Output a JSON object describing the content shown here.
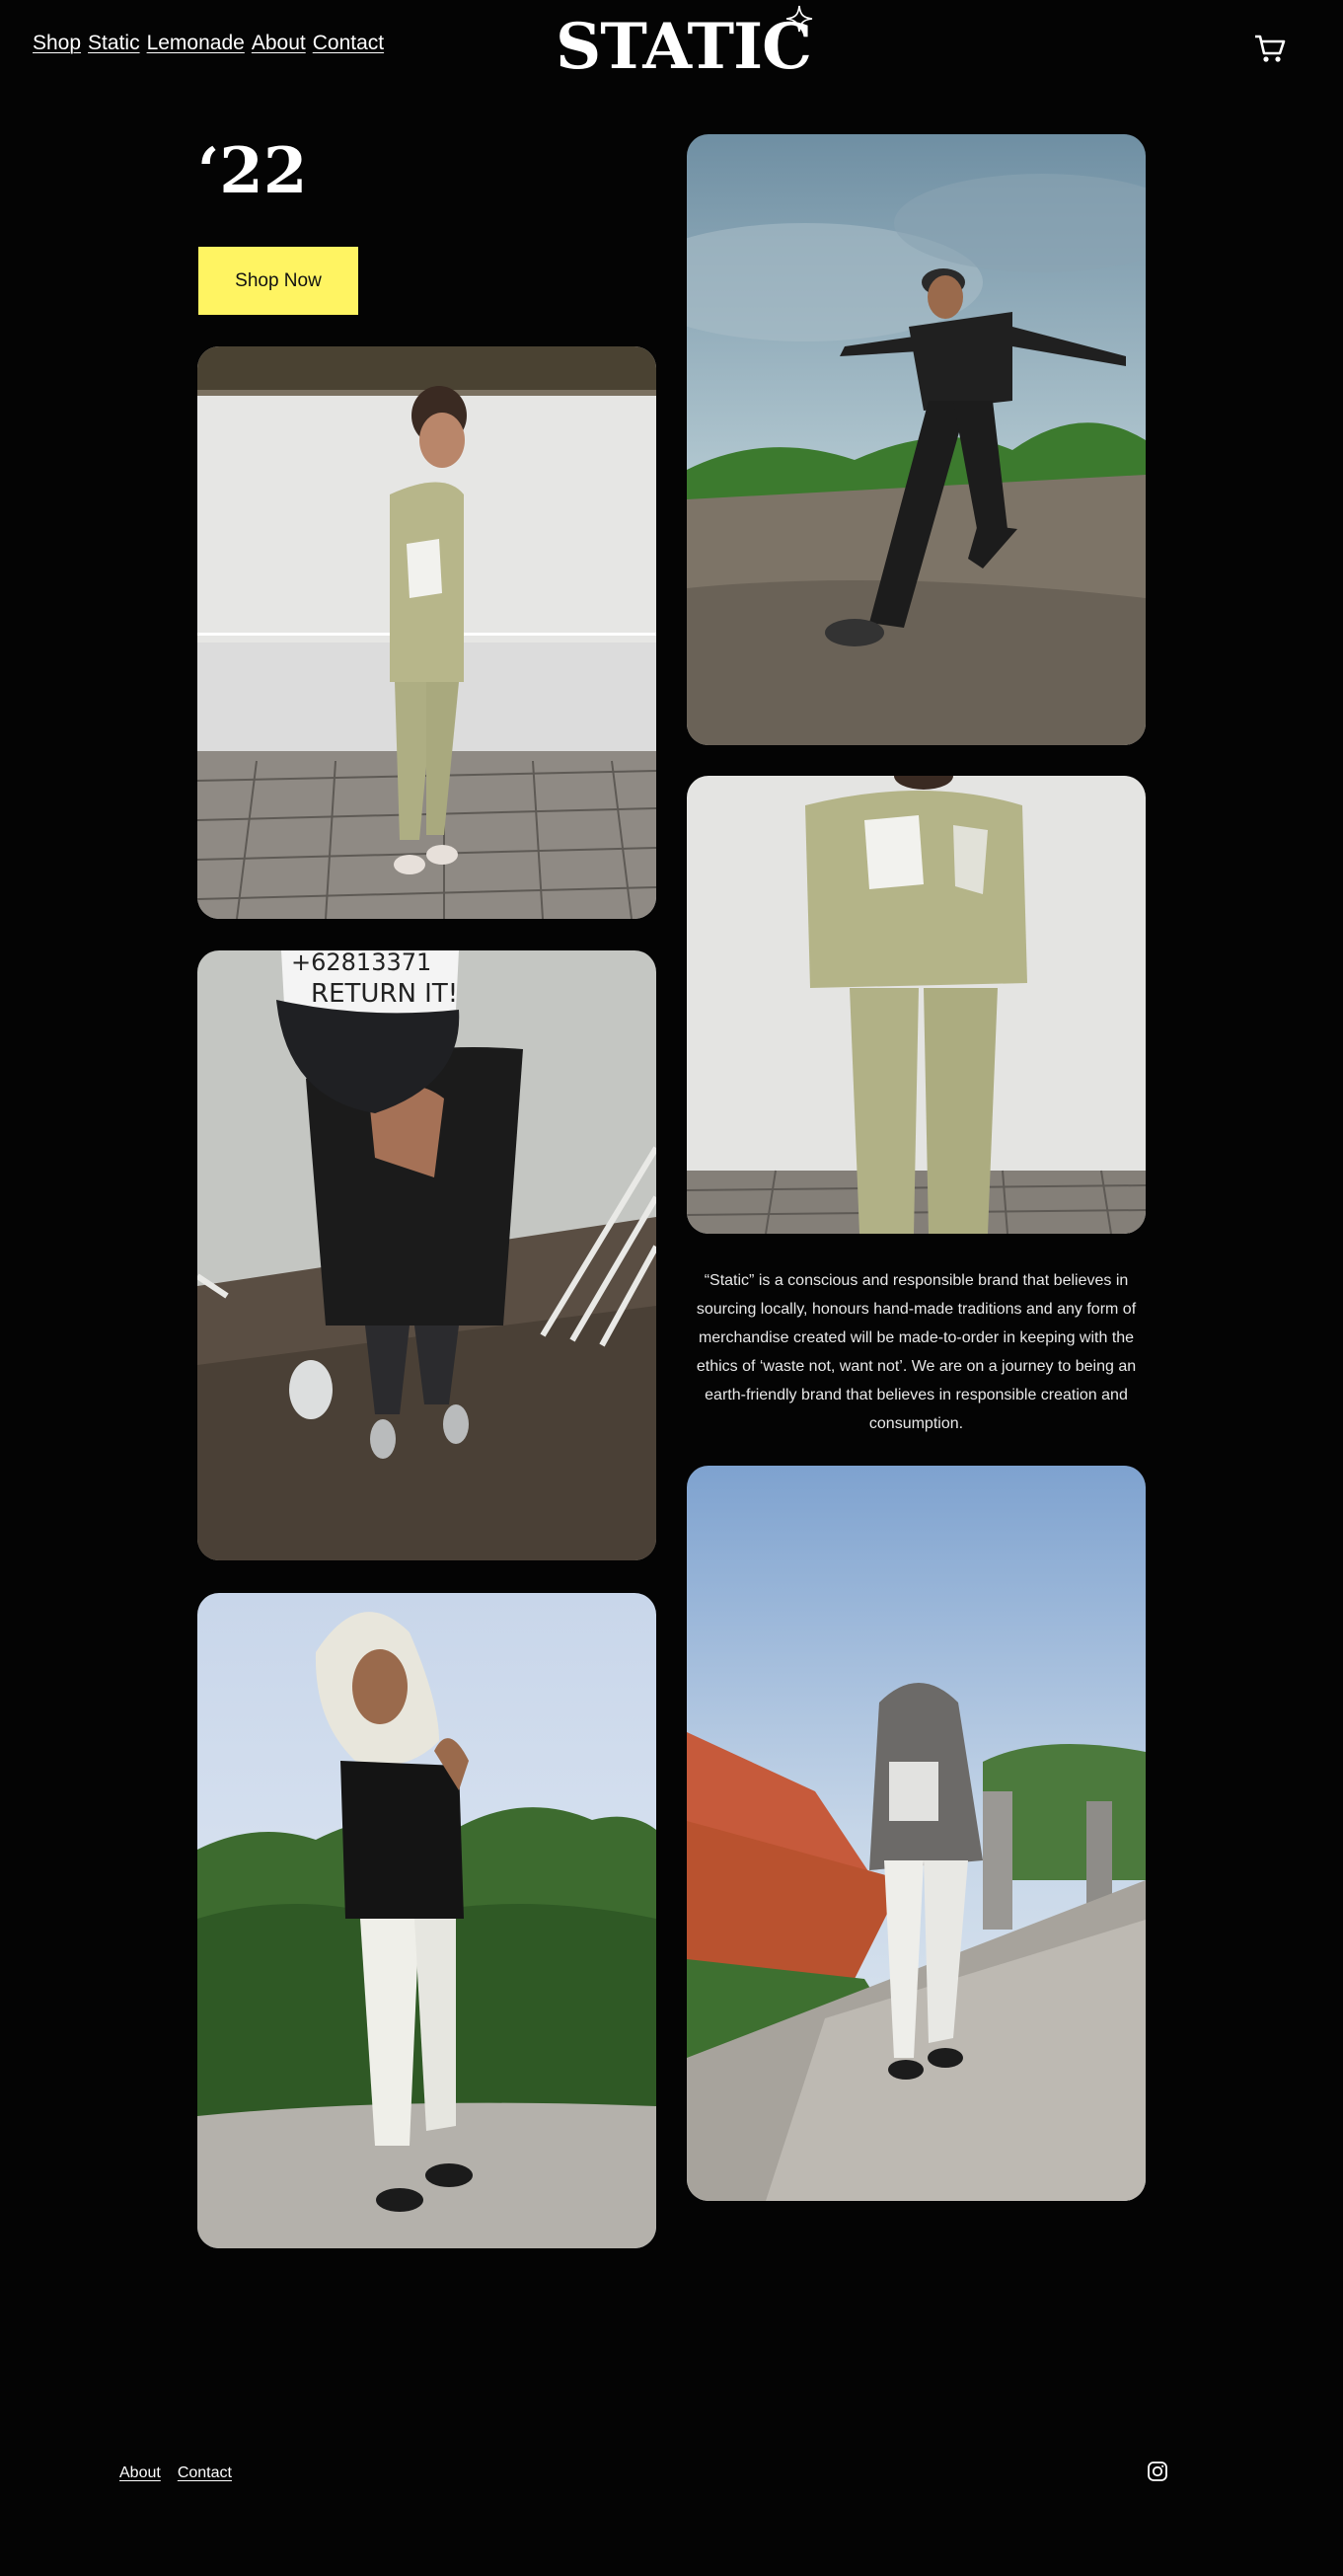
{
  "header": {
    "nav": [
      {
        "label": "Shop"
      },
      {
        "label": "Static"
      },
      {
        "label": "Lemonade"
      },
      {
        "label": "About"
      },
      {
        "label": "Contact"
      }
    ],
    "logo_text": "STATIC",
    "cart_icon": "cart-icon"
  },
  "hero": {
    "year": "‘22",
    "shop_button": "Shop Now"
  },
  "photos": [
    {
      "subject": "man in khaki painted jacket and pants against white wall"
    },
    {
      "subject": "person in cap and black tee on rocky ground"
    },
    {
      "subject": "man in knit balaclava, black tee and white cargo pants"
    },
    {
      "subject": "man in black outfit leaping on rooftop under cloudy sky"
    },
    {
      "subject": "khaki painted jacket and pants front view"
    },
    {
      "subject": "person in grey hoodie and white pants on rooftop"
    }
  ],
  "cap_text": {
    "line1": "+62813371",
    "line2": "RETURN IT!"
  },
  "about": {
    "text": "“Static” is a conscious and responsible brand that believes in sourcing locally, honours hand-made traditions and any form of merchandise created will be made-to-order in keeping with the ethics of ‘waste not, want not’. We are on a journey to being an earth-friendly brand that believes in responsible creation and consumption."
  },
  "footer": {
    "links": [
      {
        "label": "About"
      },
      {
        "label": "Contact"
      }
    ],
    "social_icon": "instagram-icon"
  },
  "colors": {
    "background": "#040404",
    "button": "#fff462",
    "text": "#ffffff"
  }
}
